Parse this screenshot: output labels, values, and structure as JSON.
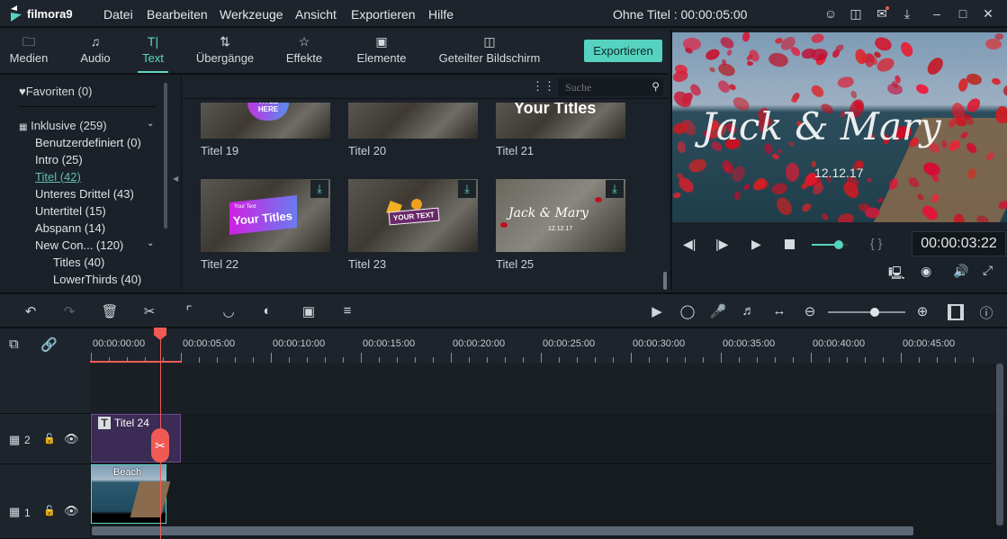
{
  "app": {
    "logo": "filmora9",
    "title": "Ohne Titel : 00:00:05:00"
  },
  "menu": [
    "Datei",
    "Bearbeiten",
    "Werkzeuge",
    "Ansicht",
    "Exportieren",
    "Hilfe"
  ],
  "window_icons": [
    "user-icon",
    "save-icon",
    "mail-icon",
    "download-icon",
    "minimize-icon",
    "maximize-icon",
    "close-icon"
  ],
  "tabs": [
    {
      "label": "Medien",
      "icon": "folder-icon"
    },
    {
      "label": "Audio",
      "icon": "music-icon"
    },
    {
      "label": "Text",
      "icon": "text-icon",
      "active": true
    },
    {
      "label": "Übergänge",
      "icon": "transition-icon"
    },
    {
      "label": "Effekte",
      "icon": "effects-icon"
    },
    {
      "label": "Elemente",
      "icon": "image-icon"
    },
    {
      "label": "Geteilter Bildschirm",
      "icon": "split-screen-icon"
    }
  ],
  "export_label": "Exportieren",
  "sidebar": {
    "favorites": "Favoriten (0)",
    "included": "Inklusive (259)",
    "items": [
      "Benutzerdefiniert (0)",
      "Intro (25)",
      "Titel (42)",
      "Unteres Drittel (43)",
      "Untertitel (15)",
      "Abspann (14)",
      "New Con... (120)"
    ],
    "active": "Titel (42)",
    "sub": [
      "Titles (40)",
      "LowerThirds (40)"
    ]
  },
  "library": {
    "search_placeholder": "Suche",
    "items": [
      {
        "label": "Titel 19",
        "overlay": "TITLE HERE"
      },
      {
        "label": "Titel 20",
        "overlay": ""
      },
      {
        "label": "Titel 21",
        "overlay": "Your Titles"
      },
      {
        "label": "Titel 22",
        "overlay": "Your Titles",
        "sub": "Your Text",
        "download": true
      },
      {
        "label": "Titel 23",
        "overlay": "YOUR TEXT",
        "download": true
      },
      {
        "label": "Titel 25",
        "overlay": "Jack & Mary",
        "sub": "12.12.17",
        "download": true
      }
    ]
  },
  "preview": {
    "title_text": "Jack & Mary",
    "date_text": "12.12.17",
    "timecode": "00:00:03:22",
    "volume": 0.75,
    "brackets": "{ }"
  },
  "timeline": {
    "ticks": [
      "00:00:00:00",
      "00:00:05:00",
      "00:00:10:00",
      "00:00:15:00",
      "00:00:20:00",
      "00:00:25:00",
      "00:00:30:00",
      "00:00:35:00",
      "00:00:40:00",
      "00:00:45:00"
    ],
    "tracks": [
      {
        "number": "2",
        "clip": "Titel 24"
      },
      {
        "number": "1",
        "clip": "Beach"
      }
    ],
    "zoom": 0.6
  },
  "colors": {
    "accent": "#56d2c1",
    "playhead": "#f05a55",
    "title_clip": "#3b2b55"
  }
}
